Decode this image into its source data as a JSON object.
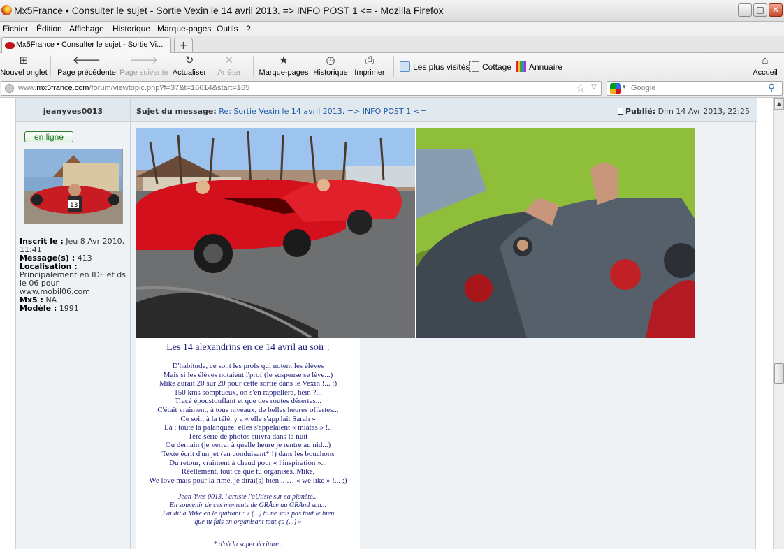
{
  "window": {
    "title": "Mx5France • Consulter le sujet - Sortie Vexin le 14 avril 2013. => INFO POST 1 <= - Mozilla Firefox",
    "buttons": {
      "minimize": "–",
      "maximize": "□",
      "close": "✕"
    }
  },
  "menu": [
    "Fichier",
    "Édition",
    "Affichage",
    "Historique",
    "Marque-pages",
    "Outils",
    "?"
  ],
  "tabs": {
    "active": "Mx5France • Consulter le sujet - Sortie Vi...",
    "new_tab": "+"
  },
  "toolbar": {
    "new_tab": "Nouvel onglet",
    "back": "Page précédente",
    "forward": "Page suivante",
    "reload": "Actualiser",
    "stop": "Arrêter",
    "bookmarks": "Marque-pages",
    "history": "Historique",
    "print": "Imprimer",
    "most_visited": "Les plus visités",
    "cottage": "Cottage",
    "annuaire": "Annuaire",
    "home": "Accueil"
  },
  "address": {
    "url_prefix": "www.",
    "url_domain": "mx5france.com",
    "url_path": "/forum/viewtopic.php?f=37&t=16614&start=165",
    "search_placeholder": "Google"
  },
  "post": {
    "author": "jeanyves0013",
    "subject_label": "Sujet du message:",
    "subject": "Re: Sortie Vexin le 14 avril 2013. => INFO POST 1 <=",
    "posted_label": "Publié:",
    "posted_date": "Dim 14 Avr 2013, 22:25",
    "online_badge": "en ligne",
    "profile": {
      "joined_label": "Inscrit le :",
      "joined": "Jeu 8 Avr 2010, 11:41",
      "messages_label": "Message(s) :",
      "messages": "413",
      "location_label": "Localisation :",
      "location": "Principalement en IDF et ds le 06 pour www.mobil06.com",
      "mx5_label": "Mx5 :",
      "mx5": "NA",
      "model_label": "Modèle :",
      "model": "1991"
    },
    "poem": {
      "title": "Les 14 alexandrins en ce 14 avril au soir :",
      "lines": [
        "D'habitude, ce sont les profs qui notent les élèves",
        "Mais si les élèves notaient l'prof (le suspense se lève...)",
        "Mike aurait 20 sur 20 pour cette sortie dans le Vexin !...  ;)",
        "150 kms somptueux, on s'en rappellera, hein ?...",
        "Tracé époustouflant et que des routes désertes...",
        "C'était vraiment, à tous niveaux, de belles heures offertes...",
        "Ce soir, à la télé, y a « elle s'app'lait Sarah »",
        "Là : toute la palanquée, elles s'appelaient « miatas » !..",
        "1ère série de photos suivra dans la nuit",
        "Ou demain (je verrai à quelle heure je rentre au nid...)",
        "Texte écrit d'un jet (en conduisant* !) dans les bouchons",
        "Du retour, vraiment  à chaud pour « l'inspiration »...",
        "Réellement, tout ce que tu organises, Mike,",
        "We love mais pour la rime, je dirai(s) bien... … « we like » !...  ;)"
      ],
      "signature_name": "Jean-Yves 0013, ",
      "signature_struck": "l'artiste",
      "signature_rest": " l'aUtiste sur sa planète...",
      "signature_lines": [
        "En souvenir de ces moments de GRÂce au GRAnd sun...",
        "J'ai dit à Mike en le quittant : « (...) tu ne sais pas tout le bien",
        "que tu fais en organisant tout ça (...) »"
      ],
      "footnote": "* d'où la super écriture :"
    }
  },
  "colors": {
    "post_bg": "#eef2f5",
    "header_bg": "#e1e9ef",
    "link": "#1c5aa8",
    "poem_text": "#1d1d7a",
    "online_green": "#1a7a1a"
  }
}
